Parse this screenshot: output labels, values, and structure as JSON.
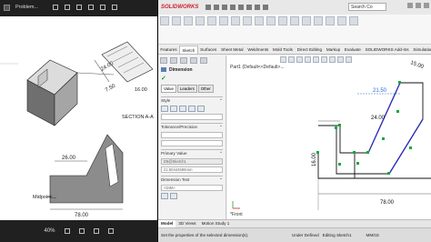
{
  "viewer": {
    "title": "Problem...",
    "zoom": "40%",
    "drawing": {
      "dims": [
        "24.00",
        "7.50",
        "16.00",
        "26.00",
        "78.00"
      ],
      "section_label": "SECTION A-A",
      "midpoint_label": "Midpoint"
    }
  },
  "sw": {
    "logo": "SOLIDWORKS",
    "search_placeholder": "Search Co",
    "tabs": [
      "Features",
      "Sketch",
      "Surfaces",
      "Sheet Metal",
      "Weldments",
      "Mold Tools",
      "Direct Editing",
      "Markup",
      "Evaluate",
      "SOLIDWORKS Add-Ins",
      "Simulation",
      "Analy"
    ],
    "active_tab": "Sketch",
    "pm": {
      "title": "Dimension",
      "subtabs": [
        "Value",
        "Leaders",
        "Other"
      ],
      "style_label": "Style",
      "tolerance_label": "Tolerance/Precision",
      "primary_value_label": "Primary Value",
      "primary_value_name": "D9@Sketch1",
      "primary_value": "21.50444595mm",
      "dim_text_label": "Dimension Text",
      "dim_text_value": "<DIM>"
    },
    "tree_item": "Part1 (Default<<Default>...",
    "dims": {
      "d1": "21.50",
      "d2": "24.00",
      "d3": "15.00",
      "d4": "16.00",
      "d5": "78.00"
    },
    "view_label": "*Front",
    "bottom_tabs": [
      "Model",
      "3D Views",
      "Motion Study 1"
    ],
    "active_bottom_tab": "Model",
    "status_msg": "Set the properties of the selected dimension(s).",
    "status_underdefined": "Under Defined",
    "status_editing": "Editing Sketch1",
    "status_units": "MMGS"
  }
}
